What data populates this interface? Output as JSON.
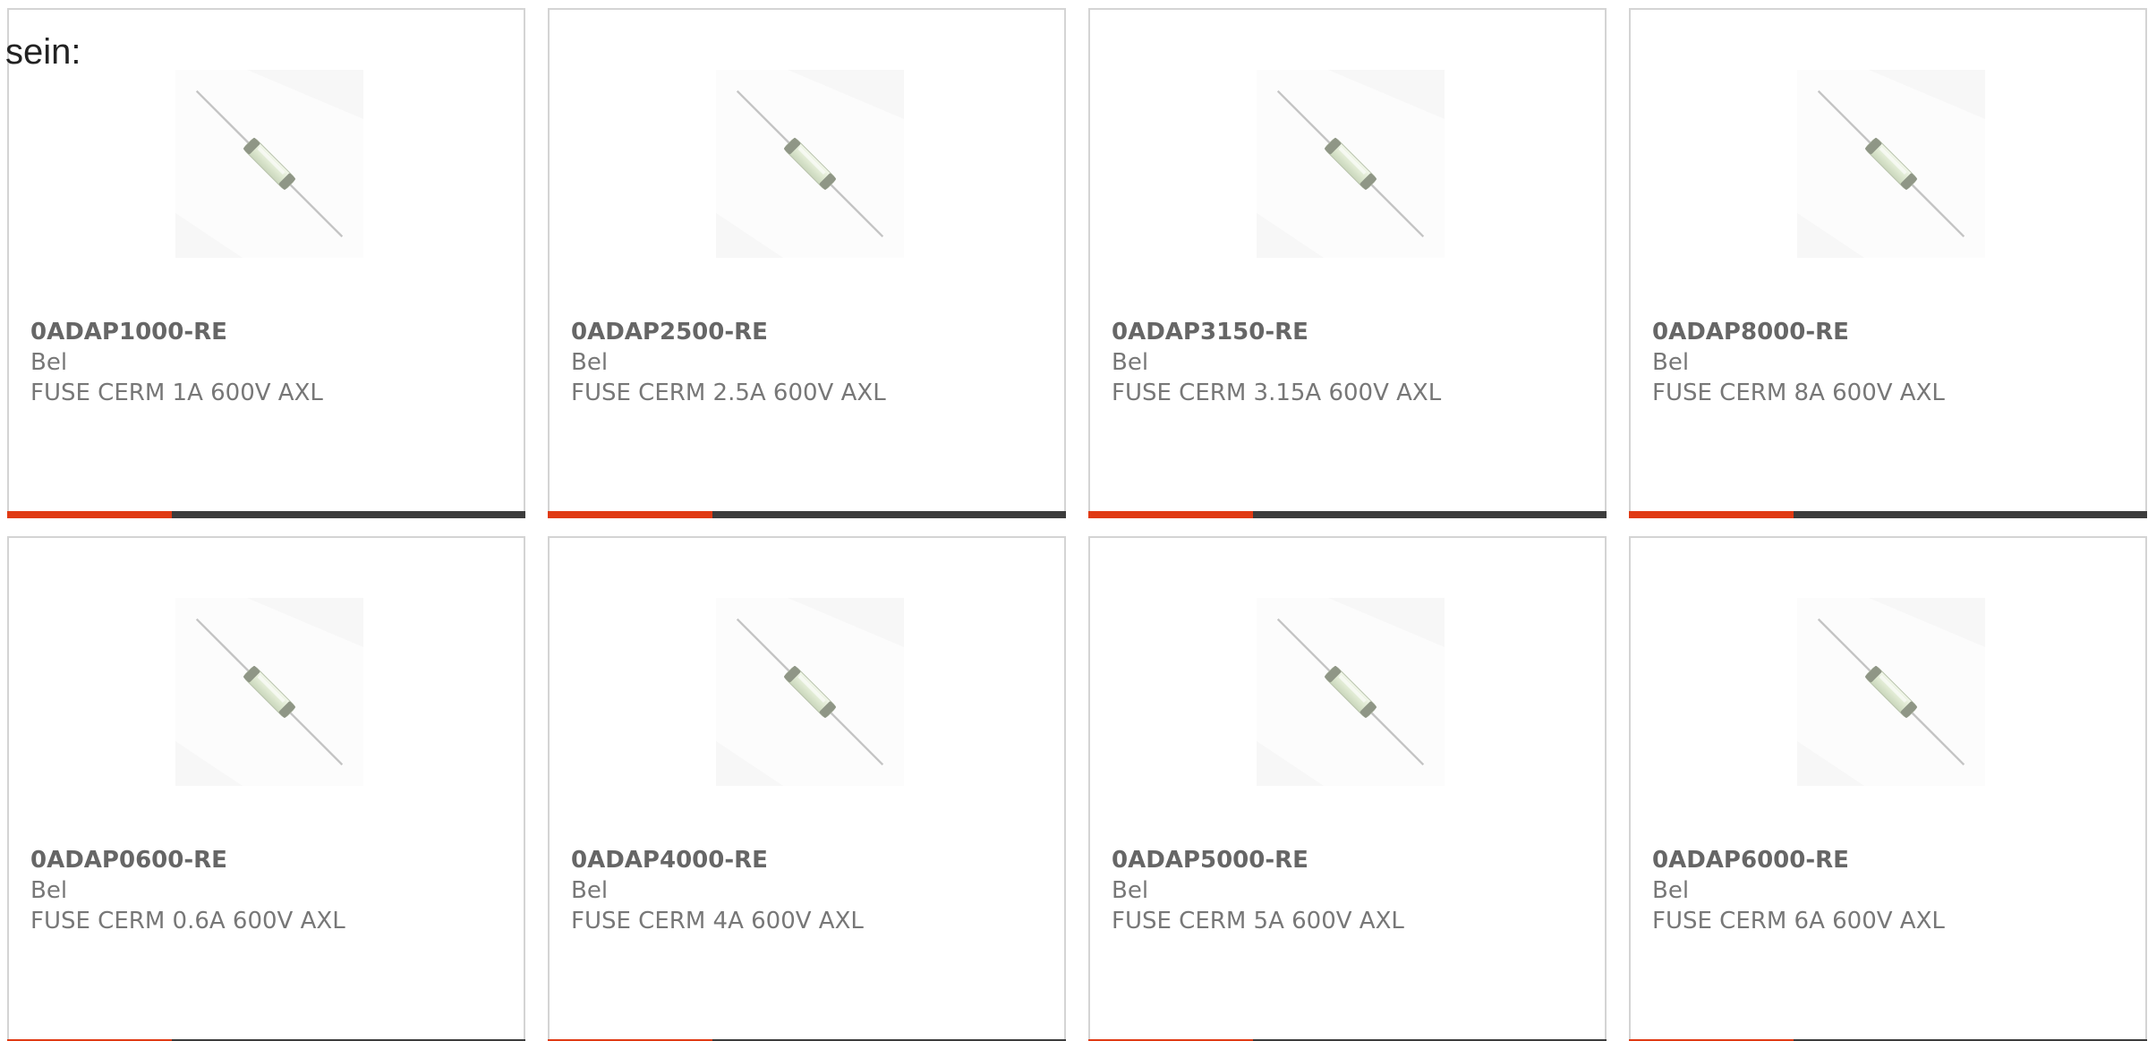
{
  "intro_text": "sein:",
  "colors": {
    "accent": "#e03a14",
    "bar": "#3c3c3c",
    "border": "#d4d4d4",
    "text_bold": "#666666",
    "text": "#777777"
  },
  "products": [
    {
      "part": "0ADAP1000-RE",
      "maker": "Bel",
      "desc": "FUSE CERM 1A 600V AXL",
      "image_icon": "axial-fuse-image"
    },
    {
      "part": "0ADAP2500-RE",
      "maker": "Bel",
      "desc": "FUSE CERM 2.5A 600V AXL",
      "image_icon": "axial-fuse-image"
    },
    {
      "part": "0ADAP3150-RE",
      "maker": "Bel",
      "desc": "FUSE CERM 3.15A 600V AXL",
      "image_icon": "axial-fuse-image"
    },
    {
      "part": "0ADAP8000-RE",
      "maker": "Bel",
      "desc": "FUSE CERM 8A 600V AXL",
      "image_icon": "axial-fuse-image"
    },
    {
      "part": "0ADAP0600-RE",
      "maker": "Bel",
      "desc": "FUSE CERM 0.6A 600V AXL",
      "image_icon": "axial-fuse-image"
    },
    {
      "part": "0ADAP4000-RE",
      "maker": "Bel",
      "desc": "FUSE CERM 4A 600V AXL",
      "image_icon": "axial-fuse-image"
    },
    {
      "part": "0ADAP5000-RE",
      "maker": "Bel",
      "desc": "FUSE CERM 5A 600V AXL",
      "image_icon": "axial-fuse-image"
    },
    {
      "part": "0ADAP6000-RE",
      "maker": "Bel",
      "desc": "FUSE CERM 6A 600V AXL",
      "image_icon": "axial-fuse-image"
    }
  ]
}
